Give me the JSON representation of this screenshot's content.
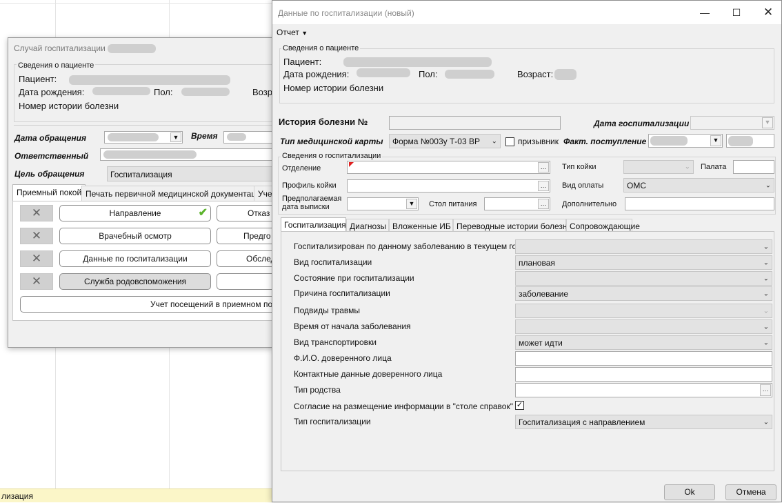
{
  "statusbar": {
    "text": "лизация"
  },
  "left_dialog": {
    "title": "Случай госпитализации",
    "patient_group": "Сведения о пациенте",
    "patient_label": "Пациент:",
    "dob_label": "Дата рождения:",
    "sex_label": "Пол:",
    "age_label": "Возр",
    "history_label": "Номер истории болезни",
    "visit_date_label": "Дата обращения",
    "time_label": "Время",
    "responsible_label": "Ответственный",
    "purpose_label": "Цель обращения",
    "purpose_value": "Госпитализация",
    "tabs": [
      "Приемный покой",
      "Печать первичной медицинской документации",
      "Учет"
    ],
    "buttons": [
      {
        "label": "Направление",
        "right": "Отказ о"
      },
      {
        "label": "Врачебный осмотр",
        "right": "Предго"
      },
      {
        "label": "Данные по госпитализации",
        "right": "Обслед"
      },
      {
        "label": "Служба родовспоможения",
        "right": ""
      }
    ],
    "wide_button": "Учет посещений в приемном поко"
  },
  "main_dialog": {
    "title": "Данные по госпитализации (новый)",
    "menu_report": "Отчет",
    "patient_group": "Сведения о пациенте",
    "patient_label": "Пациент:",
    "dob_label": "Дата рождения:",
    "sex_label": "Пол:",
    "age_label": "Возраст:",
    "history_label": "Номер истории болезни",
    "history_no_label": "История болезни №",
    "hosp_date_label": "Дата госпитализации",
    "card_type_label": "Тип медицинской карты",
    "card_type_value": "Форма №003у Т-03 ВР",
    "conscript_label": "призывник",
    "actual_arrival_label": "Факт. поступление",
    "hosp_group": "Сведения о госпитализации",
    "department_label": "Отделение",
    "bed_type_label": "Тип койки",
    "ward_label": "Палата",
    "bed_profile_label": "Профиль койки",
    "payment_label": "Вид оплаты",
    "payment_value": "ОМС",
    "discharge_label_1": "Предполагаемая",
    "discharge_label_2": "дата выписки",
    "diet_label": "Стол питания",
    "extra_label": "Дополнительно",
    "tabs": [
      "Госпитализация",
      "Диагнозы",
      "Вложенные ИБ",
      "Переводные истории болезни",
      "Сопровождающие"
    ],
    "rows": [
      {
        "label": "Госпитализирован по данному заболеванию в текущем году",
        "value": "",
        "kind": "combo-gray"
      },
      {
        "label": "Вид госпитализации",
        "value": "плановая",
        "kind": "combo-gray"
      },
      {
        "label": "Состояние при госпитализации",
        "value": "",
        "kind": "combo-gray"
      },
      {
        "label": "Причина госпитализации",
        "value": "заболевание",
        "kind": "combo-gray"
      },
      {
        "label": "Подвиды травмы",
        "value": "",
        "kind": "combo-disabled"
      },
      {
        "label": "Время от начала заболевания",
        "value": "",
        "kind": "combo-gray"
      },
      {
        "label": "Вид транспортировки",
        "value": "может идти",
        "kind": "combo-gray"
      },
      {
        "label": "Ф.И.О. доверенного лица",
        "value": "",
        "kind": "text"
      },
      {
        "label": "Контактные данные доверенного лица",
        "value": "",
        "kind": "text"
      },
      {
        "label": "Тип родства",
        "value": "",
        "kind": "lookup"
      },
      {
        "label": "Согласие на размещение информации в \"столе справок\"",
        "value": "",
        "kind": "check"
      },
      {
        "label": "Тип госпитализации",
        "value": "Госпитализация с направлением",
        "kind": "combo-gray"
      }
    ],
    "ok_button": "Ok",
    "cancel_button": "Отмена"
  }
}
